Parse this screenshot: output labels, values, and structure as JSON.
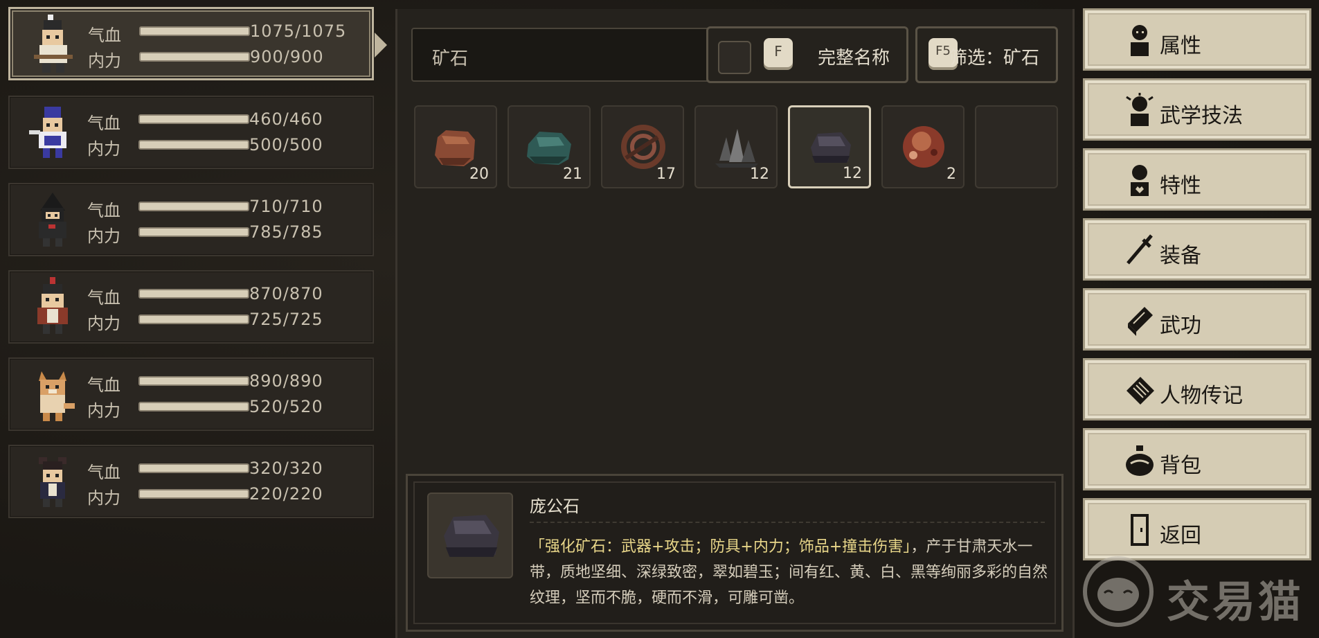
{
  "party": [
    {
      "hp_label": "气血",
      "hp": "1075/1075",
      "mp_label": "内力",
      "mp": "900/900"
    },
    {
      "hp_label": "气血",
      "hp": "460/460",
      "mp_label": "内力",
      "mp": "500/500"
    },
    {
      "hp_label": "气血",
      "hp": "710/710",
      "mp_label": "内力",
      "mp": "785/785"
    },
    {
      "hp_label": "气血",
      "hp": "870/870",
      "mp_label": "内力",
      "mp": "725/725"
    },
    {
      "hp_label": "气血",
      "hp": "890/890",
      "mp_label": "内力",
      "mp": "520/520"
    },
    {
      "hp_label": "气血",
      "hp": "320/320",
      "mp_label": "内力",
      "mp": "220/220"
    }
  ],
  "search": {
    "value": "矿石"
  },
  "options": {
    "fullname_key": "F",
    "fullname_label": "完整名称",
    "filter_key": "F5",
    "filter_label": "筛选：矿石"
  },
  "items": [
    {
      "icon": "copper-ore-icon",
      "count": "20",
      "color": "#8a4a34"
    },
    {
      "icon": "jade-ore-icon",
      "count": "21",
      "color": "#2f5a55"
    },
    {
      "icon": "coiled-ore-icon",
      "count": "17",
      "color": "#6a3a2a"
    },
    {
      "icon": "crystal-ore-icon",
      "count": "12",
      "color": "#5a5a5a"
    },
    {
      "icon": "pang-gong-stone-icon",
      "count": "12",
      "color": "#3a3640"
    },
    {
      "icon": "red-ore-icon",
      "count": "2",
      "color": "#a0513a"
    },
    {
      "icon": "empty-slot",
      "count": "",
      "color": ""
    }
  ],
  "detail": {
    "name": "庞公石",
    "highlight": "「强化矿石：武器+攻击；防具+内力；饰品+撞击伤害」",
    "description": "，产于甘肃天水一带，质地坚细、深绿致密，翠如碧玉；间有红、黄、白、黑等绚丽多彩的自然纹理，坚而不脆，硬而不滑，可雕可凿。"
  },
  "menu": [
    {
      "label": "属性",
      "icon": "person-icon"
    },
    {
      "label": "武学技法",
      "icon": "martial-arts-icon"
    },
    {
      "label": "特性",
      "icon": "trait-icon"
    },
    {
      "label": "装备",
      "icon": "sword-icon"
    },
    {
      "label": "武功",
      "icon": "book-icon"
    },
    {
      "label": "人物传记",
      "icon": "scroll-icon"
    },
    {
      "label": "背包",
      "icon": "bag-icon"
    },
    {
      "label": "返回",
      "icon": "door-icon"
    }
  ],
  "watermark": {
    "text": "交易猫"
  },
  "colors": {
    "accent": "#d5ccb4",
    "highlight_text": "#e8d689",
    "panel": "#25221d"
  }
}
